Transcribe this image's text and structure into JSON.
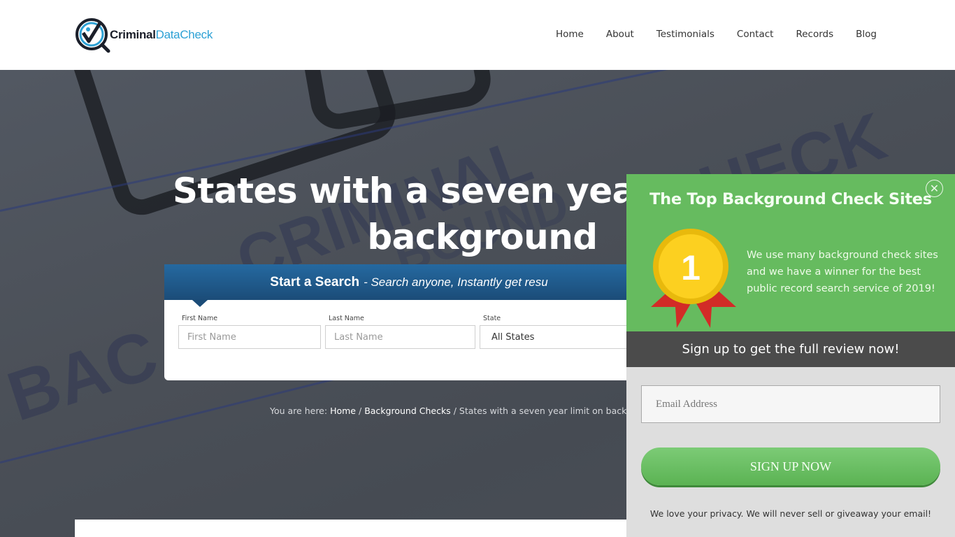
{
  "header": {
    "logo": {
      "bold": "Criminal",
      "light": "DataCheck"
    },
    "nav": [
      {
        "label": "Home"
      },
      {
        "label": "About"
      },
      {
        "label": "Testimonials"
      },
      {
        "label": "Contact"
      },
      {
        "label": "Records"
      },
      {
        "label": "Blog"
      }
    ]
  },
  "hero": {
    "title_line1": "States with a seven year",
    "title_line2": "background check",
    "background_words": [
      "CRIMINAL",
      "CHECK",
      "BAC",
      "BOUND"
    ]
  },
  "search": {
    "heading_strong": "Start a Search",
    "heading_em": "- Search anyone, Instantly get resu",
    "fields": {
      "first_name": {
        "label": "First Name",
        "placeholder": "First Name",
        "value": ""
      },
      "last_name": {
        "label": "Last Name",
        "placeholder": "Last Name",
        "value": ""
      },
      "state": {
        "label": "State",
        "selected": "All States"
      }
    }
  },
  "breadcrumb": {
    "prefix": "You are here:",
    "items": [
      {
        "label": "Home"
      },
      {
        "label": "Background Checks"
      }
    ],
    "separator": "/",
    "current": "States with a seven year limit on backg"
  },
  "popup": {
    "title": "The Top Background Check Sites",
    "close_icon": "close-icon",
    "medal_number": "1",
    "description": "We use many background check sites and we have a winner for the best public record search service of 2019!",
    "bar_text": "Sign up to get the full review now!",
    "email": {
      "placeholder": "Email Address",
      "value": ""
    },
    "button_label": "SIGN UP NOW",
    "privacy_text": "We love your privacy.  We will never sell or giveaway your email!",
    "colors": {
      "green": "#66bb5f",
      "dark_bar": "#4b4b4b",
      "panel": "#dedede"
    }
  }
}
